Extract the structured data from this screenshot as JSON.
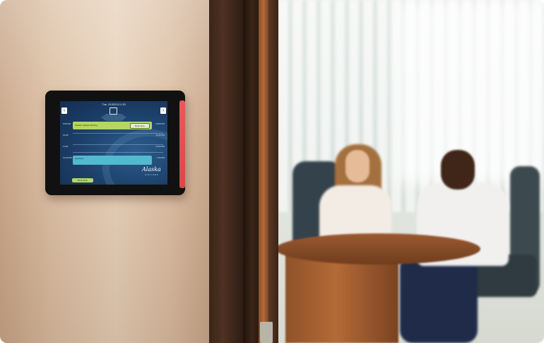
{
  "scene": {
    "colors": {
      "wall": "#dcc0a4",
      "door_frame": "#4e3122",
      "table_wood": "#9b5a30",
      "tablet_bezel": "#111111",
      "tablet_side_glow": "#e85a5a",
      "screen_bg": "#1c3f69",
      "event_green": "#b6d565",
      "event_cyan": "#52b9cf"
    }
  },
  "tablet": {
    "header_text": "Tue, 01/02/13  1:33",
    "nav": {
      "prev_icon": "chevron-left-icon",
      "next_icon": "chevron-right-icon",
      "calendar_icon": "calendar-icon"
    },
    "times_left": [
      "9:00 AM",
      "10:00",
      "11:00",
      "12:00 PM"
    ],
    "times_right": [
      "10:00 PM",
      "11:00 PM",
      "12:00 PM",
      "1:00 PM"
    ],
    "events": [
      {
        "title": "Weekly Update Meeting",
        "color": "#b6d565"
      },
      {
        "title": "Quarterly",
        "color": "#52b9cf"
      }
    ],
    "book_button_label": "Book Now",
    "bottom_button_label": "Book Now",
    "brand": {
      "name": "Alaska",
      "sub": "AIRLINES"
    }
  }
}
